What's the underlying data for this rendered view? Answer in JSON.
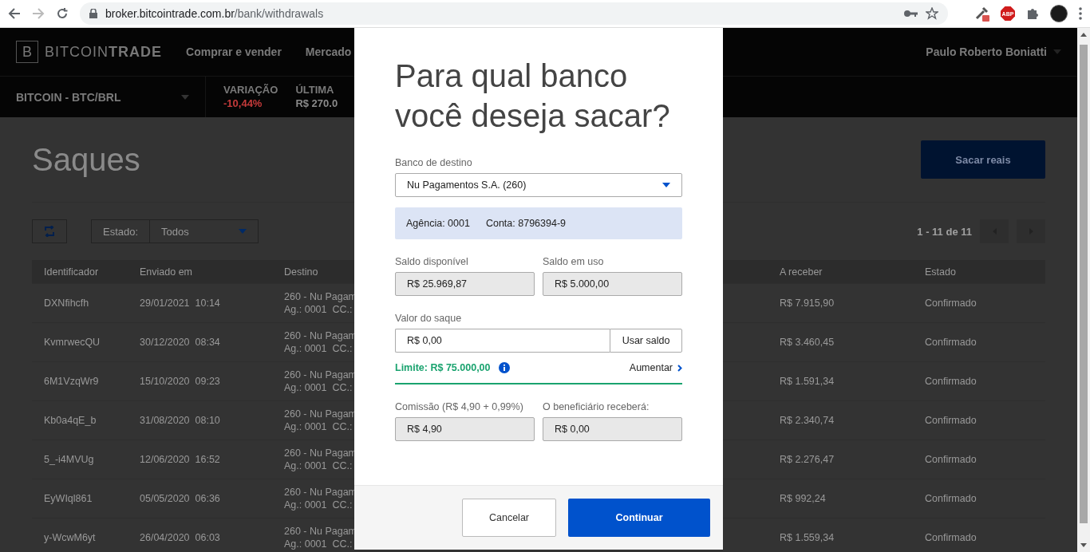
{
  "browser": {
    "url_host": "broker.bitcointrade.com.br",
    "url_path": "/bank/withdrawals",
    "extension_badge": "ABP"
  },
  "nav": {
    "logo_mark": "B",
    "brand": "BITCOIN**TRADE**",
    "links": [
      "Comprar e vender",
      "Mercado"
    ],
    "user": "Paulo Roberto Boniatti"
  },
  "market": {
    "pair": "BITCOIN - BTC/BRL",
    "stats": [
      {
        "label": "VARIAÇÃO",
        "value": "-10,44%",
        "kind": "negative"
      },
      {
        "label": "ÚLTIMA",
        "value": "R$ 270.0",
        "kind": "neutral"
      }
    ]
  },
  "page": {
    "title": "Saques",
    "primary_button": "Sacar reais",
    "filter_label": "Estado:",
    "filter_value": "Todos",
    "pagination": "1 - 11 de 11"
  },
  "table": {
    "columns": [
      "Identificador",
      "Enviado em",
      "Destino",
      "A receber",
      "Estado"
    ],
    "rows": [
      {
        "id": "DXNfihcfh",
        "sent": "29/01/2021  10:14",
        "dest_1": "260 - Nu Pagam",
        "dest_2": "Ag.: 0001  CC.:",
        "amount": "R$ 7.915,90",
        "status": "Confirmado"
      },
      {
        "id": "KvmrwecQU",
        "sent": "30/12/2020  08:34",
        "dest_1": "260 - Nu Pagam",
        "dest_2": "Ag.: 0001  CC.:",
        "amount": "R$ 3.460,45",
        "status": "Confirmado"
      },
      {
        "id": "6M1VzqWr9",
        "sent": "15/10/2020  09:23",
        "dest_1": "260 - Nu Pagam",
        "dest_2": "Ag.: 0001  CC.:",
        "amount": "R$ 1.591,34",
        "status": "Confirmado"
      },
      {
        "id": "Kb0a4qE_b",
        "sent": "31/08/2020  08:10",
        "dest_1": "260 - Nu Pagam",
        "dest_2": "Ag.: 0001  CC.:",
        "amount": "R$ 2.340,74",
        "status": "Confirmado"
      },
      {
        "id": "5_-i4MVUg",
        "sent": "12/06/2020  16:52",
        "dest_1": "260 - Nu Pagam",
        "dest_2": "Ag.: 0001  CC.:",
        "amount": "R$ 2.276,47",
        "status": "Confirmado"
      },
      {
        "id": "EyWIql861",
        "sent": "05/05/2020  06:36",
        "dest_1": "260 - Nu Pagam",
        "dest_2": "Ag.: 0001  CC.:",
        "amount": "R$ 992,24",
        "status": "Confirmado"
      },
      {
        "id": "y-WcwM6yt",
        "sent": "26/04/2020  06:03",
        "dest_1": "260 - Nu Pagam",
        "dest_2": "Ag.: 0001  CC.:",
        "amount": "R$ 1.559,34",
        "status": "Confirmado"
      }
    ]
  },
  "modal": {
    "title": "Para qual banco você deseja sacar?",
    "bank_label": "Banco de destino",
    "bank_value": "Nu Pagamentos S.A. (260)",
    "agency": "Agência: 0001",
    "account": "Conta: 8796394-9",
    "balances": [
      {
        "label": "Saldo disponível",
        "value": "R$ 25.969,87"
      },
      {
        "label": "Saldo em uso",
        "value": "R$ 5.000,00"
      }
    ],
    "amount_label": "Valor do saque",
    "amount_value": "R$ 0,00",
    "use_balance_button": "Usar saldo",
    "limit": "Limite: R$ 75.000,00",
    "increase_link": "Aumentar",
    "fees": [
      {
        "label": "Comissão (R$ 4,90 + 0,99%)",
        "value": "R$ 4,90"
      },
      {
        "label": "O beneficiário receberá:",
        "value": "R$ 0,00"
      }
    ],
    "cancel_button": "Cancelar",
    "continue_button": "Continuar"
  }
}
